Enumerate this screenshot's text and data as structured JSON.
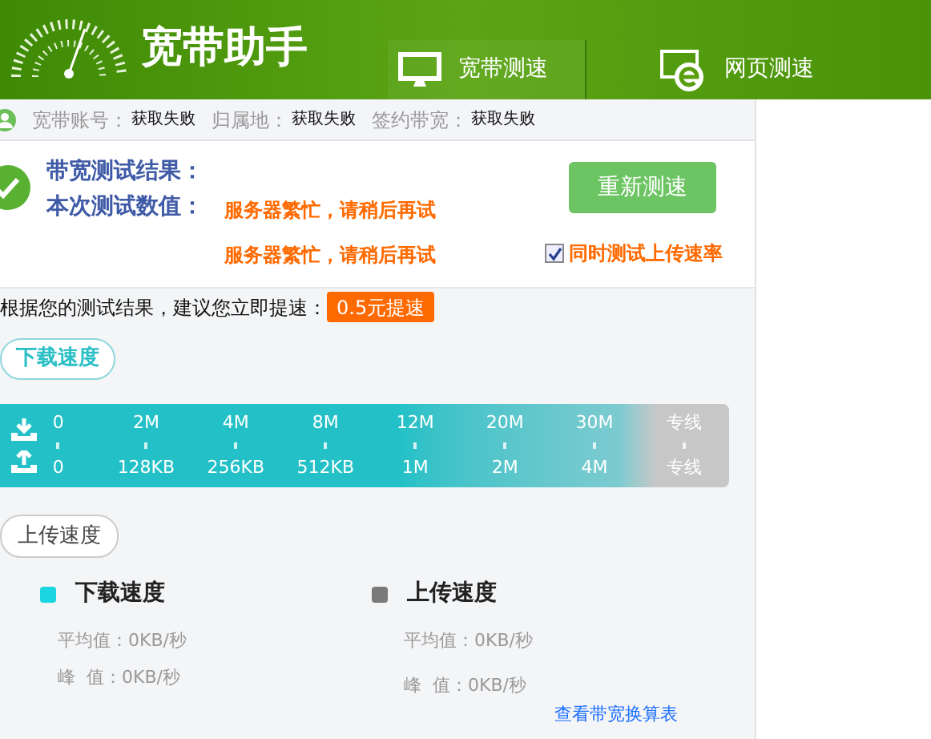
{
  "app": {
    "title": "宽带助手"
  },
  "tabs": [
    {
      "label": "宽带测速",
      "kind": "monitor",
      "selected": true
    },
    {
      "label": "网页测速",
      "kind": "browser",
      "selected": false
    }
  ],
  "info": [
    {
      "label": "宽带账号：",
      "value": "获取失败"
    },
    {
      "label": "归属地：",
      "value": "获取失败"
    },
    {
      "label": "签约带宽：",
      "value": "获取失败"
    }
  ],
  "result": {
    "title": "带宽测试结果：",
    "label": "本次测试数值：",
    "messages": [
      "服务器繁忙，请稍后再试",
      "服务器繁忙，请稍后再试"
    ],
    "retest_button": "重新测速",
    "upload_option": {
      "label": "同时测试上传速率",
      "checked": true
    }
  },
  "suggestion": {
    "text": "根据您的测试结果，建议您立即提速：",
    "button": "0.5元提速"
  },
  "download_bubble": "下载速度",
  "scale": {
    "download": [
      "0",
      "2M",
      "4M",
      "8M",
      "12M",
      "20M",
      "30M",
      "专线"
    ],
    "upload": [
      "0",
      "128KB",
      "256KB",
      "512KB",
      "1M",
      "2M",
      "4M",
      "专线"
    ]
  },
  "upload_bubble": "上传速度",
  "legend": [
    {
      "title": "下载速度",
      "color": "#1ad6e0",
      "average": "平均值：0KB/秒",
      "peak": "峰  值：0KB/秒"
    },
    {
      "title": "上传速度",
      "color": "#7a7a7a",
      "average": "平均值：0KB/秒",
      "peak": "峰  值：0KB/秒"
    }
  ],
  "link": "查看带宽换算表"
}
